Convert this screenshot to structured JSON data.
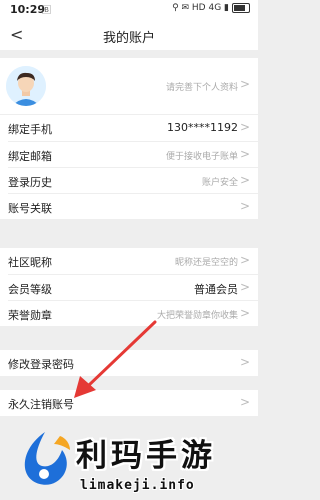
{
  "status_bar": {
    "time": "10:29",
    "system_glyph": "🄱",
    "right_text": "⚲ ✉ HD 4G ▮"
  },
  "navbar": {
    "back_symbol": "<",
    "title": "我的账户"
  },
  "profile": {
    "hint": "请完善下个人资料"
  },
  "section1": [
    {
      "label": "绑定手机",
      "value": "130****1192",
      "strong": true
    },
    {
      "label": "绑定邮箱",
      "value": "便于接收电子账单",
      "strong": false
    },
    {
      "label": "登录历史",
      "value": "账户安全",
      "strong": false
    },
    {
      "label": "账号关联",
      "value": "",
      "strong": false
    }
  ],
  "section2": [
    {
      "label": "社区昵称",
      "value": "昵称还是空空的",
      "strong": false
    },
    {
      "label": "会员等级",
      "value": "普通会员",
      "strong": true
    },
    {
      "label": "荣誉勋章",
      "value": "大把荣誉勋章你收集",
      "strong": false
    }
  ],
  "section3": [
    {
      "label": "修改登录密码",
      "value": ""
    }
  ],
  "section4": [
    {
      "label": "永久注销账号",
      "value": ""
    }
  ],
  "chevron": ">",
  "watermark": {
    "main": "利玛手游",
    "sub": "limakeji.info"
  },
  "colors": {
    "background": "#eeeeee",
    "row_bg": "#ffffff",
    "arrow": "#e53935",
    "watermark_blue": "#1e6fd9"
  }
}
